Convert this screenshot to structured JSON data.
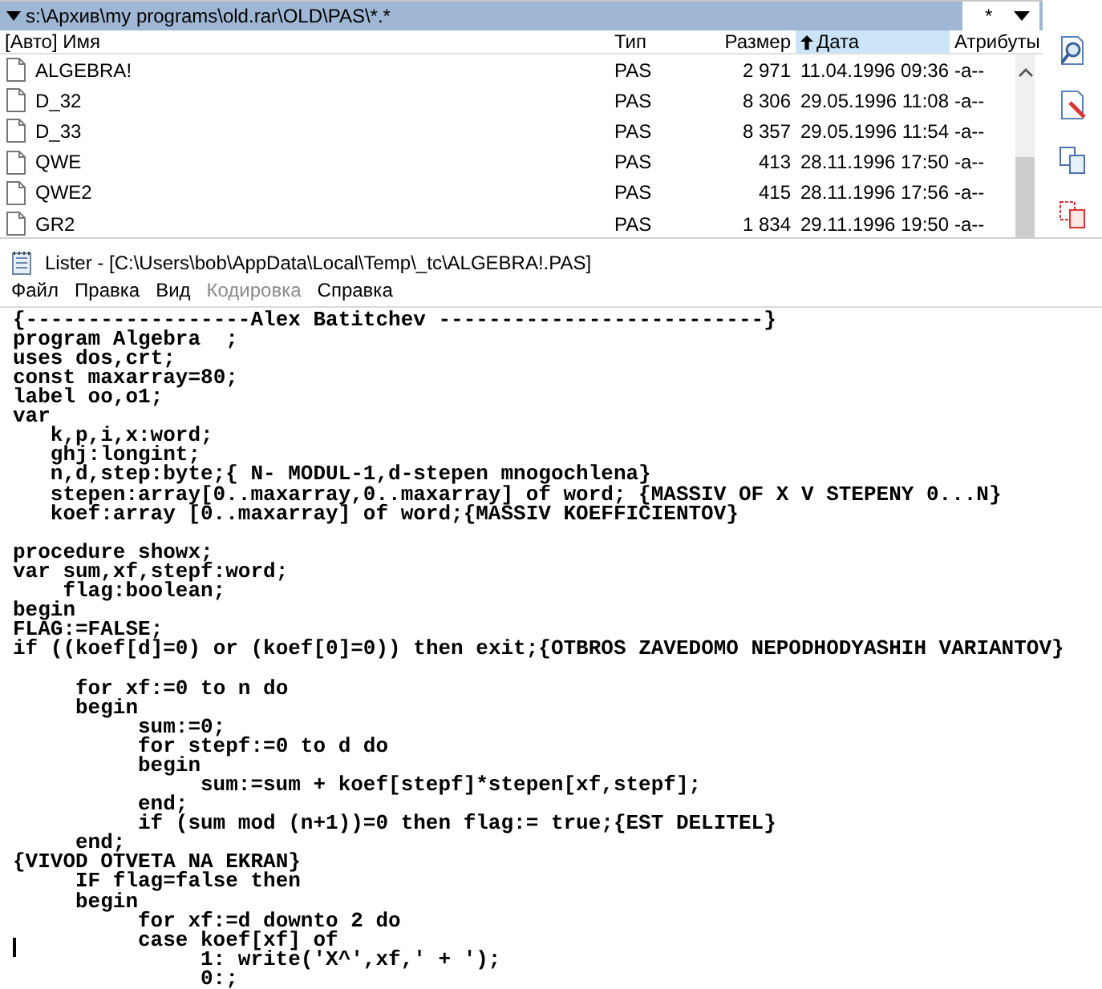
{
  "file_panel": {
    "path": "s:\\Архив\\my programs\\old.rar\\OLD\\PAS\\*.*",
    "filter": "*",
    "columns": [
      {
        "label": "[Авто] Имя",
        "selected": false
      },
      {
        "label": "Тип",
        "selected": false
      },
      {
        "label": "Размер",
        "selected": false
      },
      {
        "label": "Дата",
        "selected": true
      },
      {
        "label": "Атрибуты",
        "selected": false
      }
    ],
    "rows": [
      {
        "name": "ALGEBRA!",
        "type": "PAS",
        "size": "2 971",
        "date": "11.04.1996 09:36",
        "attributes": "-a--"
      },
      {
        "name": "D_32",
        "type": "PAS",
        "size": "8 306",
        "date": "29.05.1996 11:08",
        "attributes": "-a--"
      },
      {
        "name": "D_33",
        "type": "PAS",
        "size": "8 357",
        "date": "29.05.1996 11:54",
        "attributes": "-a--"
      },
      {
        "name": "QWE",
        "type": "PAS",
        "size": "413",
        "date": "28.11.1996 17:50",
        "attributes": "-a--"
      },
      {
        "name": "QWE2",
        "type": "PAS",
        "size": "415",
        "date": "28.11.1996 17:56",
        "attributes": "-a--"
      },
      {
        "name": "GR2",
        "type": "PAS",
        "size": "1 834",
        "date": "29.11.1996 19:50",
        "attributes": "-a--"
      }
    ]
  },
  "lister": {
    "title": "Lister - [C:\\Users\\bob\\AppData\\Local\\Temp\\_tc\\ALGEBRA!.PAS]",
    "menu": [
      {
        "label": "Файл",
        "disabled": false
      },
      {
        "label": "Правка",
        "disabled": false
      },
      {
        "label": "Вид",
        "disabled": false
      },
      {
        "label": "Кодировка",
        "disabled": true
      },
      {
        "label": "Справка",
        "disabled": false
      }
    ],
    "code_blocks": [
      [
        "{------------------Alex Batitchev --------------------------}",
        "program Algebra  ;",
        "uses dos,crt;",
        "const maxarray=80;",
        "label oo,o1;",
        "var",
        "   k,p,i,x:word;",
        "   ghj:longint;",
        "   n,d,step:byte;{ N- MODUL-1,d-stepen mnogochlena}",
        "   stepen:array[0..maxarray,0..maxarray] of word; {MASSIV OF X V STEPENY 0...N}",
        "   koef:array [0..maxarray] of word;{MASSIV KOEFFICIENTOV}"
      ],
      [
        "procedure showx;",
        "var sum,xf,stepf:word;",
        "    flag:boolean;",
        "begin",
        "FLAG:=FALSE;",
        "if ((koef[d]=0) or (koef[0]=0)) then exit;{OTBROS ZAVEDOMO NEPODHODYASHIH VARIANTOV}"
      ],
      [
        "     for xf:=0 to n do",
        "     begin",
        "          sum:=0;",
        "          for stepf:=0 to d do",
        "          begin",
        "               sum:=sum + koef[stepf]*stepen[xf,stepf];",
        "          end;",
        "          if (sum mod (n+1))=0 then flag:= true;{EST DELITEL}",
        "     end;",
        "{VIVOD OTVETA NA EKRAN}",
        "     IF flag=false then",
        "     begin",
        "          for xf:=d downto 2 do",
        "          case koef[xf] of",
        "               1: write('X^',xf,' + ');",
        "               0:;"
      ]
    ]
  }
}
